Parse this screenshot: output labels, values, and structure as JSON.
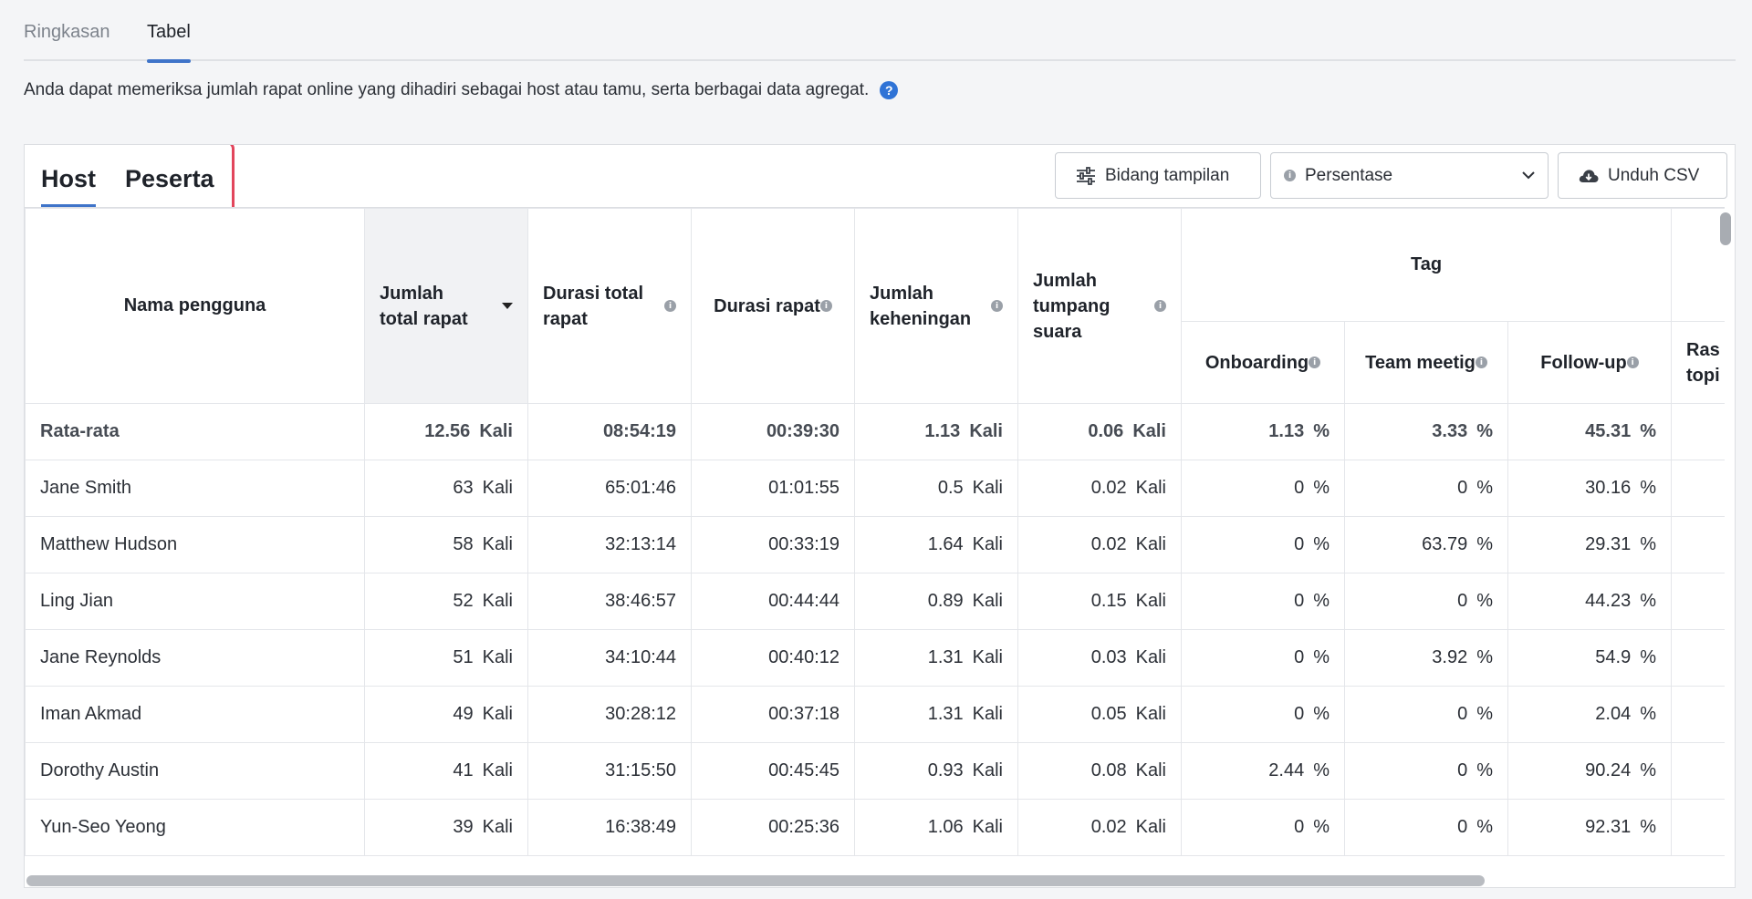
{
  "page_tabs": [
    {
      "label": "Ringkasan"
    },
    {
      "label": "Tabel"
    }
  ],
  "description": "Anda dapat memeriksa jumlah rapat online yang dihadiri sebagai host atau tamu, serta berbagai data agregat.",
  "help_icon": "?",
  "sub_tabs": [
    {
      "label": "Host"
    },
    {
      "label": "Peserta"
    }
  ],
  "toolbar": {
    "fields_label": "Bidang tampilan",
    "select_value": "Persentase",
    "csv_label": "Unduh CSV"
  },
  "icons": {
    "info": "i"
  },
  "columns": {
    "name": "Nama pengguna",
    "total_meetings": "Jumlah total rapat",
    "total_duration": "Durasi total rapat",
    "meeting_duration": "Durasi rapat",
    "silence_count": "Jumlah keheningan",
    "overlap_count": "Jumlah tumpang suara",
    "tag_group": "Tag",
    "tag_onboarding": "Onboarding",
    "tag_team": "Team meetig",
    "tag_followup": "Follow-up",
    "cut_off": "Ras topi"
  },
  "units": {
    "times": "Kali",
    "percent": "%"
  },
  "average": {
    "label": "Rata-rata",
    "total": "12.56",
    "duration_total": "08:54:19",
    "duration": "00:39:30",
    "silence": "1.13",
    "overlap": "0.06",
    "onboarding": "1.13",
    "team": "3.33",
    "followup": "45.31"
  },
  "rows": [
    {
      "name": "Jane Smith",
      "total": "63",
      "duration_total": "65:01:46",
      "duration": "01:01:55",
      "silence": "0.5",
      "overlap": "0.02",
      "onboarding": "0",
      "team": "0",
      "followup": "30.16"
    },
    {
      "name": "Matthew Hudson",
      "total": "58",
      "duration_total": "32:13:14",
      "duration": "00:33:19",
      "silence": "1.64",
      "overlap": "0.02",
      "onboarding": "0",
      "team": "63.79",
      "followup": "29.31"
    },
    {
      "name": "Ling Jian",
      "total": "52",
      "duration_total": "38:46:57",
      "duration": "00:44:44",
      "silence": "0.89",
      "overlap": "0.15",
      "onboarding": "0",
      "team": "0",
      "followup": "44.23"
    },
    {
      "name": "Jane Reynolds",
      "total": "51",
      "duration_total": "34:10:44",
      "duration": "00:40:12",
      "silence": "1.31",
      "overlap": "0.03",
      "onboarding": "0",
      "team": "3.92",
      "followup": "54.9"
    },
    {
      "name": "Iman Akmad",
      "total": "49",
      "duration_total": "30:28:12",
      "duration": "00:37:18",
      "silence": "1.31",
      "overlap": "0.05",
      "onboarding": "0",
      "team": "0",
      "followup": "2.04"
    },
    {
      "name": "Dorothy Austin",
      "total": "41",
      "duration_total": "31:15:50",
      "duration": "00:45:45",
      "silence": "0.93",
      "overlap": "0.08",
      "onboarding": "2.44",
      "team": "0",
      "followup": "90.24"
    },
    {
      "name": "Yun-Seo Yeong",
      "total": "39",
      "duration_total": "16:38:49",
      "duration": "00:25:36",
      "silence": "1.06",
      "overlap": "0.02",
      "onboarding": "0",
      "team": "0",
      "followup": "92.31"
    }
  ]
}
